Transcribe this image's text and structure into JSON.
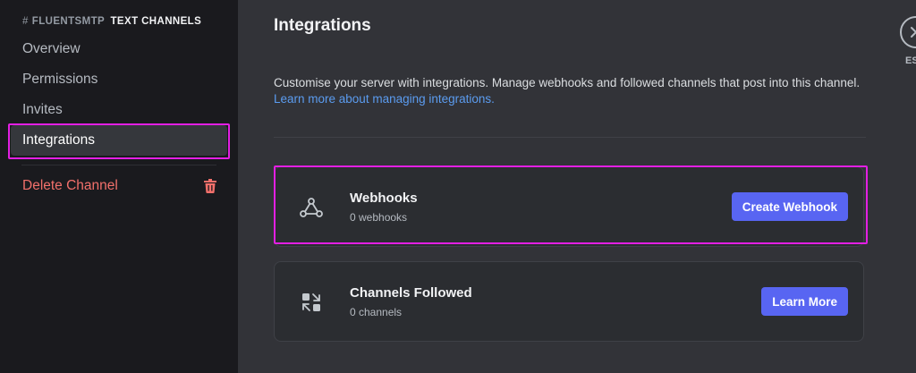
{
  "sidebar": {
    "header": {
      "hash": "#",
      "server": "FLUENTSMTP",
      "category": "TEXT CHANNELS"
    },
    "items": [
      {
        "label": "Overview"
      },
      {
        "label": "Permissions"
      },
      {
        "label": "Invites"
      },
      {
        "label": "Integrations"
      },
      {
        "label": "Delete Channel"
      }
    ]
  },
  "main": {
    "title": "Integrations",
    "description": "Customise your server with integrations. Manage webhooks and followed channels that post into this channel.",
    "learn_more_link": "Learn more about managing integrations.",
    "cards": [
      {
        "title": "Webhooks",
        "subtitle": "0 webhooks",
        "button": "Create Webhook",
        "icon": "webhook-icon"
      },
      {
        "title": "Channels Followed",
        "subtitle": "0 channels",
        "button": "Learn More",
        "icon": "channels-followed-icon"
      }
    ]
  },
  "close": {
    "label": "ESC"
  },
  "colors": {
    "sidebar_bg": "#1a1a1e",
    "main_bg": "#323338",
    "accent": "#5865f2",
    "link": "#5b9cf0",
    "danger": "#f2706b",
    "highlight": "#e31fe3"
  }
}
